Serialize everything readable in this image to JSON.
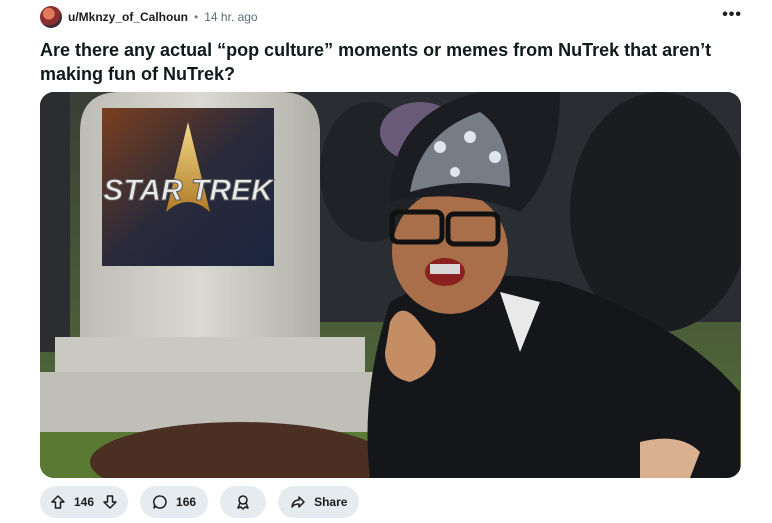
{
  "post": {
    "username": "u/Mknzy_of_Calhoun",
    "separator": "•",
    "time": "14 hr. ago",
    "overflow": "•••",
    "title": "Are there any actual “pop culture” moments or memes from NuTrek that aren’t making fun of NuTrek?"
  },
  "image": {
    "logo_text": "STAR TREK"
  },
  "actions": {
    "upvotes": "146",
    "comments": "166",
    "share_label": "Share"
  },
  "icons": [
    "avatar",
    "overflow-menu-icon",
    "upvote-icon",
    "downvote-icon",
    "comment-icon",
    "award-icon",
    "share-icon"
  ]
}
